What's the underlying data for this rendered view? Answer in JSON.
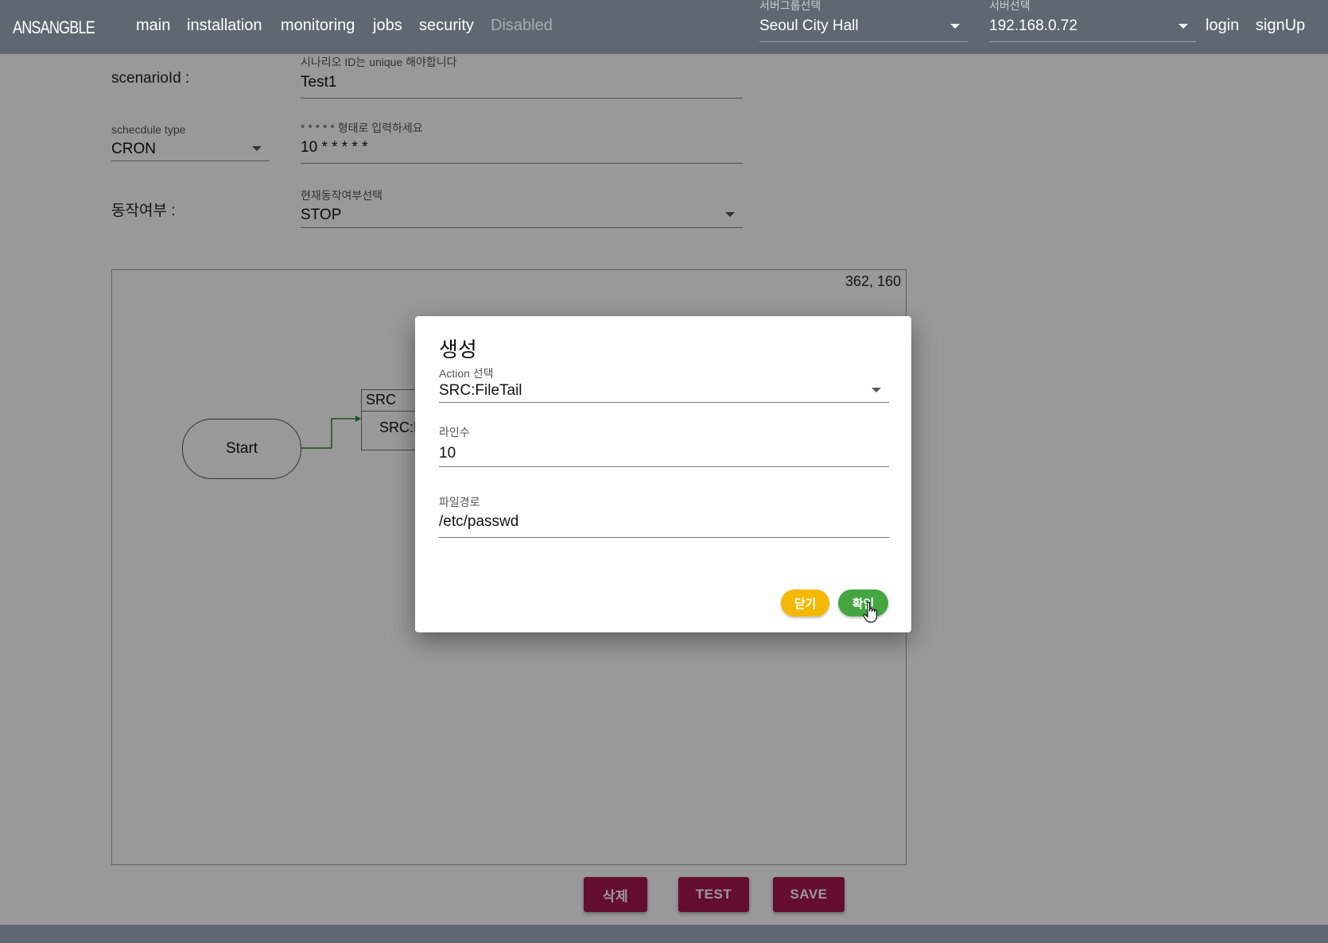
{
  "header": {
    "logo": "ANSANGBLE",
    "nav": [
      {
        "label": "main"
      },
      {
        "label": "installation"
      },
      {
        "label": "monitoring"
      },
      {
        "label": "jobs"
      },
      {
        "label": "security"
      },
      {
        "label": "Disabled",
        "disabled": true
      }
    ],
    "server_group": {
      "caption": "서버그룹선택",
      "value": "Seoul City Hall"
    },
    "server": {
      "caption": "서버선택",
      "value": "192.168.0.72"
    },
    "login_label": "login",
    "signup_label": "signUp",
    "bar_color": "#5f6772"
  },
  "form": {
    "scenario_label": "scenarioId :",
    "scenario_caption": "시나리오 ID는 unique 해야합니다",
    "scenario_value": "Test1",
    "schedule_type_caption": "schecdule type",
    "schedule_type_value": "CRON",
    "cron_caption": "* * * * * 형태로 입력하세요",
    "cron_value": "10 * * * * *",
    "active_label": "동작여부 :",
    "active_caption": "현재동작여부선택",
    "active_value": "STOP"
  },
  "canvas": {
    "coords": "362, 160",
    "start_node": "Start",
    "src_node_header": "SRC",
    "src_node_body": "SRC:FileTail",
    "connector_color": "#2e8b2e"
  },
  "actions": {
    "delete_label": "삭제",
    "test_label": "TEST",
    "save_label": "SAVE",
    "color": "#a8174f"
  },
  "dialog": {
    "title": "생성",
    "action_caption": "Action 선택",
    "action_value": "SRC:FileTail",
    "lines_caption": "라인수",
    "lines_value": "10",
    "path_caption": "파일경로",
    "path_value": "/etc/passwd",
    "close_label": "닫기",
    "confirm_label": "확인",
    "close_color": "#f5b800",
    "confirm_color": "#43a63f"
  }
}
